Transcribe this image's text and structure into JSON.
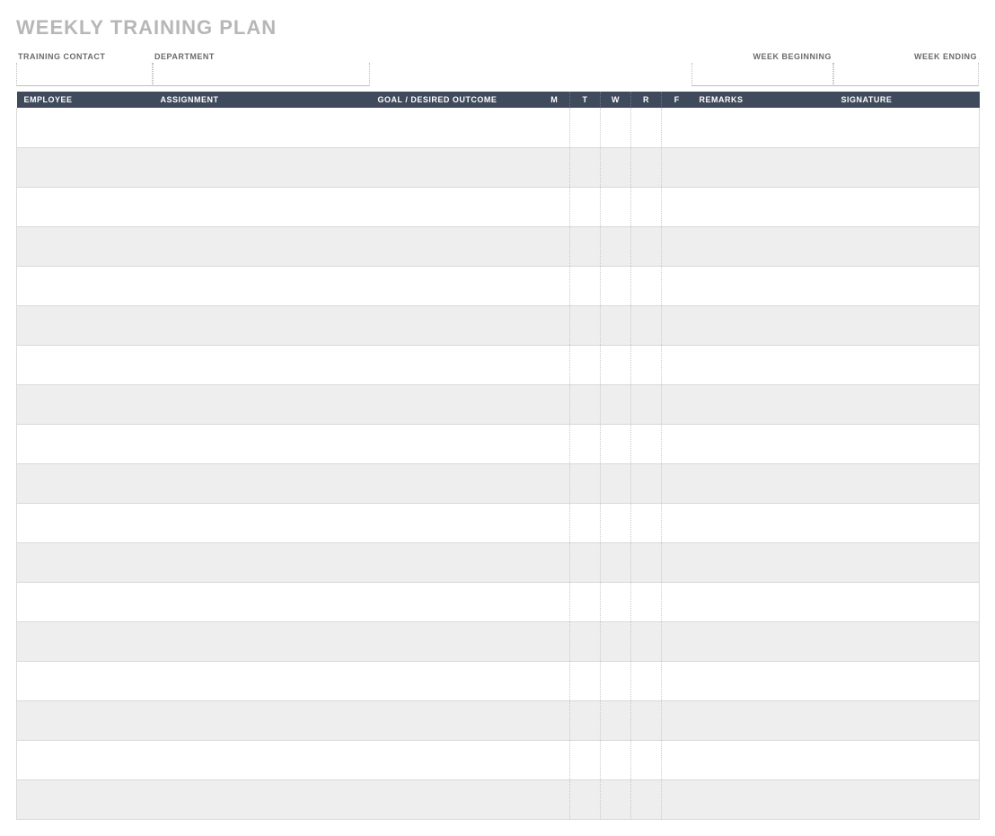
{
  "title": "WEEKLY TRAINING PLAN",
  "meta": {
    "training_contact": {
      "label": "TRAINING CONTACT",
      "value": ""
    },
    "department": {
      "label": "DEPARTMENT",
      "value": ""
    },
    "week_beginning": {
      "label": "WEEK BEGINNING",
      "value": ""
    },
    "week_ending": {
      "label": "WEEK ENDING",
      "value": ""
    }
  },
  "columns": {
    "employee": "EMPLOYEE",
    "assignment": "ASSIGNMENT",
    "goal": "GOAL / DESIRED OUTCOME",
    "days": {
      "m": "M",
      "t": "T",
      "w": "W",
      "r": "R",
      "f": "F"
    },
    "remarks": "REMARKS",
    "signature": "SIGNATURE"
  },
  "rows": [
    {
      "employee": "",
      "assignment": "",
      "goal": "",
      "m": "",
      "t": "",
      "w": "",
      "r": "",
      "f": "",
      "remarks": "",
      "signature": ""
    },
    {
      "employee": "",
      "assignment": "",
      "goal": "",
      "m": "",
      "t": "",
      "w": "",
      "r": "",
      "f": "",
      "remarks": "",
      "signature": ""
    },
    {
      "employee": "",
      "assignment": "",
      "goal": "",
      "m": "",
      "t": "",
      "w": "",
      "r": "",
      "f": "",
      "remarks": "",
      "signature": ""
    },
    {
      "employee": "",
      "assignment": "",
      "goal": "",
      "m": "",
      "t": "",
      "w": "",
      "r": "",
      "f": "",
      "remarks": "",
      "signature": ""
    },
    {
      "employee": "",
      "assignment": "",
      "goal": "",
      "m": "",
      "t": "",
      "w": "",
      "r": "",
      "f": "",
      "remarks": "",
      "signature": ""
    },
    {
      "employee": "",
      "assignment": "",
      "goal": "",
      "m": "",
      "t": "",
      "w": "",
      "r": "",
      "f": "",
      "remarks": "",
      "signature": ""
    },
    {
      "employee": "",
      "assignment": "",
      "goal": "",
      "m": "",
      "t": "",
      "w": "",
      "r": "",
      "f": "",
      "remarks": "",
      "signature": ""
    },
    {
      "employee": "",
      "assignment": "",
      "goal": "",
      "m": "",
      "t": "",
      "w": "",
      "r": "",
      "f": "",
      "remarks": "",
      "signature": ""
    },
    {
      "employee": "",
      "assignment": "",
      "goal": "",
      "m": "",
      "t": "",
      "w": "",
      "r": "",
      "f": "",
      "remarks": "",
      "signature": ""
    },
    {
      "employee": "",
      "assignment": "",
      "goal": "",
      "m": "",
      "t": "",
      "w": "",
      "r": "",
      "f": "",
      "remarks": "",
      "signature": ""
    },
    {
      "employee": "",
      "assignment": "",
      "goal": "",
      "m": "",
      "t": "",
      "w": "",
      "r": "",
      "f": "",
      "remarks": "",
      "signature": ""
    },
    {
      "employee": "",
      "assignment": "",
      "goal": "",
      "m": "",
      "t": "",
      "w": "",
      "r": "",
      "f": "",
      "remarks": "",
      "signature": ""
    },
    {
      "employee": "",
      "assignment": "",
      "goal": "",
      "m": "",
      "t": "",
      "w": "",
      "r": "",
      "f": "",
      "remarks": "",
      "signature": ""
    },
    {
      "employee": "",
      "assignment": "",
      "goal": "",
      "m": "",
      "t": "",
      "w": "",
      "r": "",
      "f": "",
      "remarks": "",
      "signature": ""
    },
    {
      "employee": "",
      "assignment": "",
      "goal": "",
      "m": "",
      "t": "",
      "w": "",
      "r": "",
      "f": "",
      "remarks": "",
      "signature": ""
    },
    {
      "employee": "",
      "assignment": "",
      "goal": "",
      "m": "",
      "t": "",
      "w": "",
      "r": "",
      "f": "",
      "remarks": "",
      "signature": ""
    },
    {
      "employee": "",
      "assignment": "",
      "goal": "",
      "m": "",
      "t": "",
      "w": "",
      "r": "",
      "f": "",
      "remarks": "",
      "signature": ""
    },
    {
      "employee": "",
      "assignment": "",
      "goal": "",
      "m": "",
      "t": "",
      "w": "",
      "r": "",
      "f": "",
      "remarks": "",
      "signature": ""
    }
  ]
}
